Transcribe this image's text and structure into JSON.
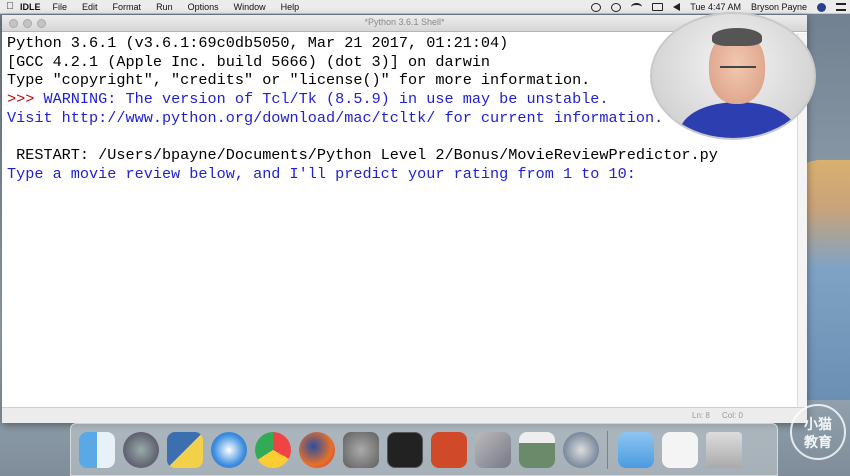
{
  "menubar": {
    "app_name": "IDLE",
    "items": [
      "File",
      "Edit",
      "Format",
      "Run",
      "Options",
      "Window",
      "Help"
    ],
    "clock": "Tue 4:47 AM",
    "user": "Bryson Payne"
  },
  "window": {
    "title": "*Python 3.6.1 Shell*"
  },
  "shell": {
    "lines": [
      "Python 3.6.1 (v3.6.1:69c0db5050, Mar 21 2017, 01:21:04)",
      "[GCC 4.2.1 (Apple Inc. build 5666) (dot 3)] on darwin",
      "Type \"copyright\", \"credits\" or \"license()\" for more information.",
      "WARNING: The version of Tcl/Tk (8.5.9) in use may be unstable.",
      "Visit http://www.python.org/download/mac/tcltk/ for current information.",
      "",
      " RESTART: /Users/bpayne/Documents/Python Level 2/Bonus/MovieReviewPredictor.py",
      "Type a movie review below, and I'll predict your rating from 1 to 10:"
    ],
    "prompt": ">>> "
  },
  "statusbar": {
    "line": "Ln: 8",
    "col": "Col: 0"
  },
  "dock": {
    "apps": [
      "finder-icon",
      "launchpad-icon",
      "python-launcher-icon",
      "safari-icon",
      "chrome-icon",
      "firefox-icon",
      "system-preferences-icon",
      "terminal-icon",
      "powerpoint-icon",
      "virtualbox-icon",
      "screenshot-icon",
      "quicktime-icon",
      "folder-icon",
      "downloads-icon",
      "trash-icon"
    ]
  },
  "watermark": {
    "line1": "小猫",
    "line2": "教育"
  },
  "colors": {
    "stdout": "#000000",
    "stderr_prompt": "#c00000",
    "blue_output": "#1f1fd6"
  }
}
